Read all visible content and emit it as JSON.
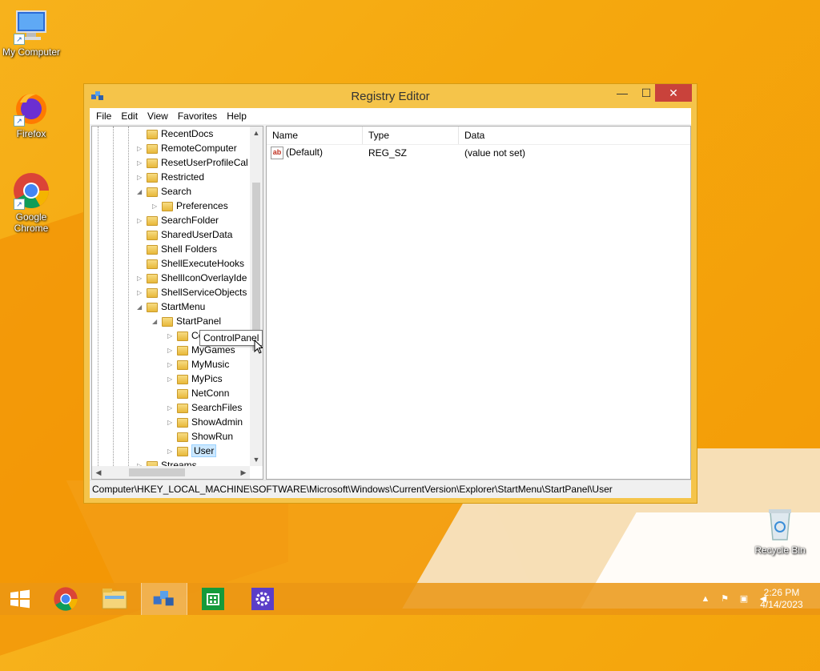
{
  "desktop": {
    "icons": [
      {
        "label": "My Computer"
      },
      {
        "label": "Firefox"
      },
      {
        "label": "Google Chrome"
      },
      {
        "label": "Recycle Bin"
      }
    ]
  },
  "window": {
    "title": "Registry Editor",
    "controls": {
      "minimize": "—",
      "maximize": "☐",
      "close": "✕"
    },
    "menu": [
      "File",
      "Edit",
      "View",
      "Favorites",
      "Help"
    ]
  },
  "tree": {
    "nodes": [
      {
        "label": "RecentDocs",
        "expander": "",
        "depth": 0
      },
      {
        "label": "RemoteComputer",
        "expander": "▷",
        "depth": 0
      },
      {
        "label": "ResetUserProfileCal",
        "expander": "▷",
        "depth": 0
      },
      {
        "label": "Restricted",
        "expander": "▷",
        "depth": 0
      },
      {
        "label": "Search",
        "expander": "◢",
        "depth": 0
      },
      {
        "label": "Preferences",
        "expander": "▷",
        "depth": 1
      },
      {
        "label": "SearchFolder",
        "expander": "▷",
        "depth": 0
      },
      {
        "label": "SharedUserData",
        "expander": "",
        "depth": 0
      },
      {
        "label": "Shell Folders",
        "expander": "",
        "depth": 0
      },
      {
        "label": "ShellExecuteHooks",
        "expander": "",
        "depth": 0
      },
      {
        "label": "ShellIconOverlayIde",
        "expander": "▷",
        "depth": 0
      },
      {
        "label": "ShellServiceObjects",
        "expander": "▷",
        "depth": 0
      },
      {
        "label": "StartMenu",
        "expander": "◢",
        "depth": 0
      },
      {
        "label": "StartPanel",
        "expander": "◢",
        "depth": 1
      },
      {
        "label": "ControlPanel",
        "expander": "▷",
        "depth": 2
      },
      {
        "label": "MyGames",
        "expander": "▷",
        "depth": 2
      },
      {
        "label": "MyMusic",
        "expander": "▷",
        "depth": 2
      },
      {
        "label": "MyPics",
        "expander": "▷",
        "depth": 2
      },
      {
        "label": "NetConn",
        "expander": "",
        "depth": 2
      },
      {
        "label": "SearchFiles",
        "expander": "▷",
        "depth": 2
      },
      {
        "label": "ShowAdmin",
        "expander": "▷",
        "depth": 2
      },
      {
        "label": "ShowRun",
        "expander": "",
        "depth": 2
      },
      {
        "label": "User",
        "expander": "▷",
        "depth": 2,
        "selected": true
      },
      {
        "label": "Streams",
        "expander": "▷",
        "depth": 0
      }
    ],
    "tooltip": "ControlPanel"
  },
  "values": {
    "columns": [
      "Name",
      "Type",
      "Data"
    ],
    "rows": [
      {
        "name": "(Default)",
        "type": "REG_SZ",
        "data": "(value not set)",
        "icon": "ab"
      }
    ]
  },
  "status": {
    "path": "Computer\\HKEY_LOCAL_MACHINE\\SOFTWARE\\Microsoft\\Windows\\CurrentVersion\\Explorer\\StartMenu\\StartPanel\\User"
  },
  "taskbar": {
    "buttons": [
      "start-button",
      "chrome",
      "file-explorer",
      "registry-editor",
      "store",
      "settings"
    ],
    "clock": {
      "time": "2:26 PM",
      "date": "4/14/2023"
    },
    "tray_icons": [
      "show-hidden-icons-arrow",
      "action-center-icon",
      "network-icon",
      "volume-muted-icon"
    ]
  },
  "colors": {
    "accent_taskbar": "#eb9614",
    "close_button": "#c9423b",
    "selection": "#cce8ff"
  }
}
